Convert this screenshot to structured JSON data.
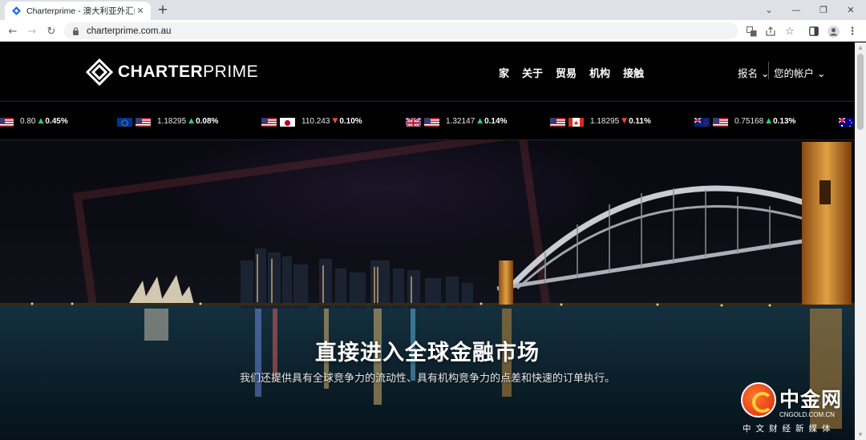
{
  "browser": {
    "tab_title": "Charterprime - 澳大利亚外汇经",
    "url": "charterprime.com.au"
  },
  "site": {
    "logo_bold": "CHARTER",
    "logo_light": "PRIME",
    "nav": [
      "家",
      "关于",
      "贸易",
      "机构",
      "接触"
    ],
    "register": "报名",
    "account": "您的帐户"
  },
  "ticker": [
    {
      "flags": [
        "us"
      ],
      "price": "0.80",
      "dir": "up",
      "pct": "0.45%"
    },
    {
      "flags": [
        "eu",
        "us"
      ],
      "price": "1.18295",
      "dir": "up",
      "pct": "0.08%"
    },
    {
      "flags": [
        "us",
        "jp"
      ],
      "price": "110.243",
      "dir": "down",
      "pct": "0.10%"
    },
    {
      "flags": [
        "gb",
        "us"
      ],
      "price": "1.32147",
      "dir": "up",
      "pct": "0.14%"
    },
    {
      "flags": [
        "us",
        "ca"
      ],
      "price": "1.18295",
      "dir": "down",
      "pct": "0.11%"
    },
    {
      "flags": [
        "nz",
        "us"
      ],
      "price": "0.75168",
      "dir": "up",
      "pct": "0.13%"
    }
  ],
  "hero": {
    "title": "直接进入全球金融市场",
    "subtitle": "我们还提供具有全球竞争力的流动性、具有机构竞争力的点差和快速的订单执行。"
  },
  "watermark": {
    "name": "中金网",
    "url": "CNGOLD.COM.CN",
    "tagline": "中文财经新媒体"
  },
  "colors": {
    "up": "#2ecc71",
    "down": "#e74c3c"
  }
}
